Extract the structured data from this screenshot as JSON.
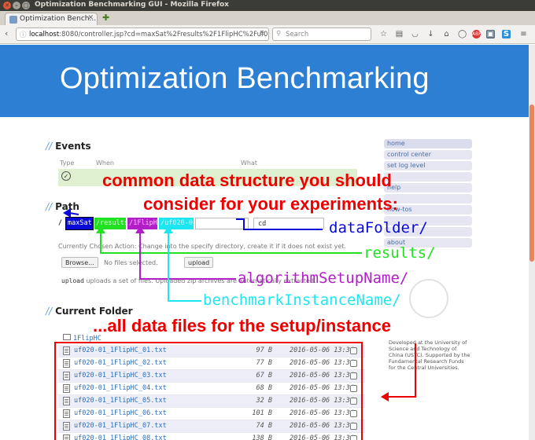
{
  "window": {
    "title": "Optimization Benchmarking GUI - Mozilla Firefox",
    "tab_label": "Optimization Bench...",
    "url_host": "localhost",
    "url_rest": ":8080/controller.jsp?cd=maxSat%2Fresults%2F1FlipHC%2Fuf02",
    "search_placeholder": "Search"
  },
  "page": {
    "header_title": "Optimization Benchmarking"
  },
  "sidebar": {
    "items": [
      "home",
      "control center",
      "set log level",
      "",
      "help",
      "",
      "how-tos",
      "",
      "",
      "about"
    ]
  },
  "footer": {
    "text": "Developed at the University of Science and Technology of China (USTC). Supported by the Fundamental Research Funds for the Central Universities."
  },
  "events": {
    "heading": "Events",
    "col_type": "Type",
    "col_when": "When",
    "col_what": "What"
  },
  "path": {
    "heading": "Path",
    "root": "/",
    "segments": [
      "maxSat",
      "/results",
      "/1FlipHC",
      "/uf020-01"
    ],
    "cd_button": "cd",
    "current_action": "Currently Chosen Action: Change into the specify directory, create it if it does not exist yet.",
    "browse_button": "Browse...",
    "no_files": "No files selected.",
    "upload_button": "upload",
    "upload_help": "uploads a set of files. Uploaded zip archives are automatically extracted."
  },
  "current_folder": {
    "heading": "Current Folder",
    "folder_link": "1FlipHC",
    "files": [
      {
        "name": "uf020-01_1FlipHC_01.txt",
        "size": "97 B",
        "date": "2016-05-06 13:34"
      },
      {
        "name": "uf020-01_1FlipHC_02.txt",
        "size": "77 B",
        "date": "2016-05-06 13:34"
      },
      {
        "name": "uf020-01_1FlipHC_03.txt",
        "size": "67 B",
        "date": "2016-05-06 13:34"
      },
      {
        "name": "uf020-01_1FlipHC_04.txt",
        "size": "68 B",
        "date": "2016-05-06 13:34"
      },
      {
        "name": "uf020-01_1FlipHC_05.txt",
        "size": "32 B",
        "date": "2016-05-06 13:34"
      },
      {
        "name": "uf020-01_1FlipHC_06.txt",
        "size": "101 B",
        "date": "2016-05-06 13:34"
      },
      {
        "name": "uf020-01_1FlipHC_07.txt",
        "size": "74 B",
        "date": "2016-05-06 13:34"
      },
      {
        "name": "uf020-01_1FlipHC_08.txt",
        "size": "138 B",
        "date": "2016-05-06 13:34"
      }
    ]
  },
  "annotations": {
    "line1": "common data structure you should",
    "line2": "consider for your experiments:",
    "dataFolder": "dataFolder/",
    "results": "results/",
    "algorithmSetupName": "algorithmSetupName/",
    "benchmarkInstanceName": "benchmarkInstanceName/",
    "all_files": "...all data files for the setup/instance"
  },
  "colors": {
    "header_blue": "#2c7fd2",
    "ann_red": "#e00000",
    "seg_dataFolder": "#0a0ad8",
    "seg_results": "#22e022",
    "seg_algorithm": "#b41ec8",
    "seg_benchmark": "#1ee6f0"
  }
}
